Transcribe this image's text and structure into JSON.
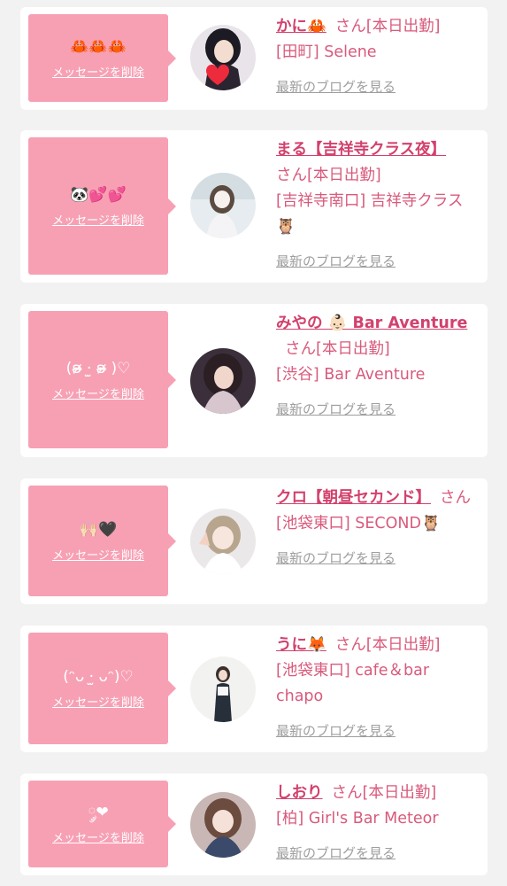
{
  "delete_label": "メッセージを削除",
  "blog_label": "最新のブログを見る",
  "cards": [
    {
      "message": "🦀🦀🦀",
      "name": "かに🦀",
      "suffix": "さん[本日出勤]",
      "shop": "[田町] Selene"
    },
    {
      "message": "🐼💕💕",
      "name": "まる【吉祥寺クラス夜】",
      "suffix": "さん[本日出勤]",
      "shop": "[吉祥寺南口] 吉祥寺クラス🦉"
    },
    {
      "message": "(ʚ̴̶̷̷ ·̫ ʚ̴̶̷̷ )♡",
      "name": "みやの 👶🏻 Bar Aventure",
      "suffix": "さん[本日出勤]",
      "shop": "[渋谷] Bar Aventure"
    },
    {
      "message": "🙌🏻🖤",
      "name": "クロ【朝昼セカンド】",
      "suffix": "さん",
      "shop": "[池袋東口] SECOND🦉"
    },
    {
      "message": "(ᵔᴗ ·̫ ᴗᵔ)♡",
      "name": "うに🦊",
      "suffix": "さん[本日出勤]",
      "shop": "[池袋東口] cafe＆bar chapo"
    },
    {
      "message": "༘❤︎",
      "name": "しおり",
      "suffix": "さん[本日出勤]",
      "shop": "[柏] Girl's Bar Meteor"
    }
  ],
  "colors": {
    "bubble": "#f7a0b4",
    "name": "#d2416d",
    "text": "#d85a7c",
    "link_gray": "#9e9e9e",
    "background": "#f2f2f2"
  }
}
